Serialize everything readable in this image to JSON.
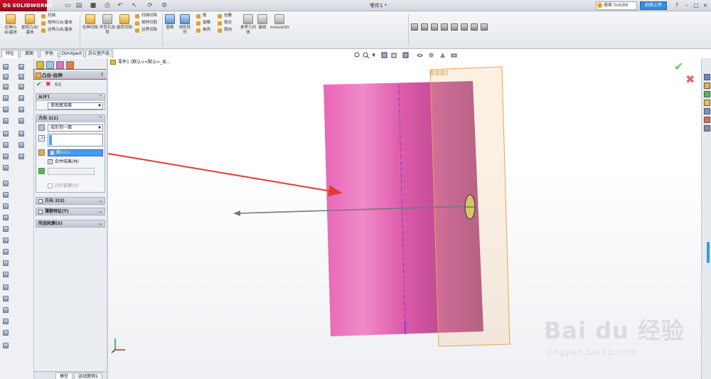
{
  "app": {
    "logo_text": "SOLIDWORKS",
    "logo_mark": "DS",
    "document_title": "零件1 *"
  },
  "titlebar": {
    "search_placeholder": "搜索 SolidW",
    "upload_label": "拍照上传",
    "help_glyph": "?",
    "minimize_glyph": "–",
    "restore_glyph": "□",
    "close_glyph": "×"
  },
  "commands": {
    "extrude_boss": "拉伸凸台/基体",
    "revolve_boss": "旋转凸台/基体",
    "sweep": "扫描",
    "loft": "放样凸台/基体",
    "boundary_boss": "边界凸台/基体",
    "extrude_cut": "拉伸切除",
    "hole_wizard": "异型孔向导",
    "revolve_cut": "旋转切除",
    "sweep_cut": "扫描切除",
    "loft_cut": "放样切割",
    "boundary_cut": "边界切除",
    "fillet": "圆角",
    "linear_pattern": "线性阵列",
    "rib": "筋",
    "draft": "拔模",
    "shell": "抽壳",
    "wrap": "包覆",
    "intersect": "相交",
    "mirror": "镜向",
    "ref_geometry": "参考几何体",
    "curves": "曲线",
    "instant3d": "Instant3D"
  },
  "tabs": [
    {
      "label": "特征"
    },
    {
      "label": "草图"
    },
    {
      "label": "评估"
    },
    {
      "label": "DimXpert"
    },
    {
      "label": "办公室产品"
    }
  ],
  "property_manager": {
    "title": "凸台-拉伸",
    "help": "?",
    "ok_glyph": "✔",
    "cancel_glyph": "✖",
    "detail_glyph": "6d",
    "from_group": {
      "header": "从(F)",
      "value": "草图基准面"
    },
    "direction1": {
      "header": "方向 1(1)",
      "end_condition": "成形到一面",
      "face_value": "面<1>",
      "merge_result_label": "合并结果(M)",
      "merge_checked": "✓",
      "draft_outward_label": "向外拔模(O)"
    },
    "direction2": {
      "header": "方向 2(2)"
    },
    "thin_feature": {
      "header": "薄壁特征(T)"
    },
    "selected_contours": {
      "header": "所选轮廓(S)"
    },
    "chevron_up": "⌃",
    "chevron_down": "⌄"
  },
  "bottom_tabs": [
    {
      "label": "模型"
    },
    {
      "label": "运动算例1"
    }
  ],
  "graphics": {
    "tree_text": "零件1 (默认<<默认>_显...",
    "plane_label": "基准面1",
    "ok_glyph": "✔",
    "cancel_glyph": "✖"
  },
  "watermark": {
    "main": "Bai du 经验",
    "sub": "jingyan.baidu.com"
  },
  "colors": {
    "body_pink": "#e05aa8",
    "plane_orange": "#f0a050",
    "annotation_red": "#e53a34",
    "axis_blue": "#3b3bd8"
  }
}
